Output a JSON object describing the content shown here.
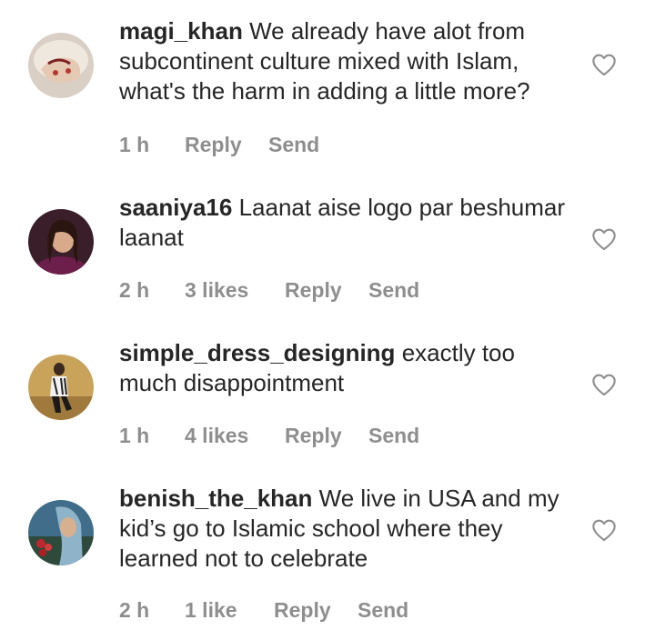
{
  "comments": [
    {
      "username": "magi_khan",
      "text": "We already have alot from subcontinent culture mixed with Islam, what's the harm in adding a little more?",
      "time": "1 h",
      "likes": "",
      "reply": "Reply",
      "send": "Send"
    },
    {
      "username": "saaniya16",
      "text": "Laanat aise logo par beshumar laanat",
      "time": "2 h",
      "likes": "3 likes",
      "reply": "Reply",
      "send": "Send"
    },
    {
      "username": "simple_dress_designing",
      "text": "exactly too much disappointment",
      "time": "1 h",
      "likes": "4 likes",
      "reply": "Reply",
      "send": "Send"
    },
    {
      "username": "benish_the_khan",
      "text": "We live in USA and my kid’s go to Islamic school where they learned not to celebrate",
      "time": "2 h",
      "likes": "1 like",
      "reply": "Reply",
      "send": "Send"
    }
  ],
  "icons": {
    "like": "heart-outline-icon"
  },
  "colors": {
    "primary_text": "#262626",
    "secondary_text": "#8e8e8e",
    "background": "#ffffff"
  }
}
